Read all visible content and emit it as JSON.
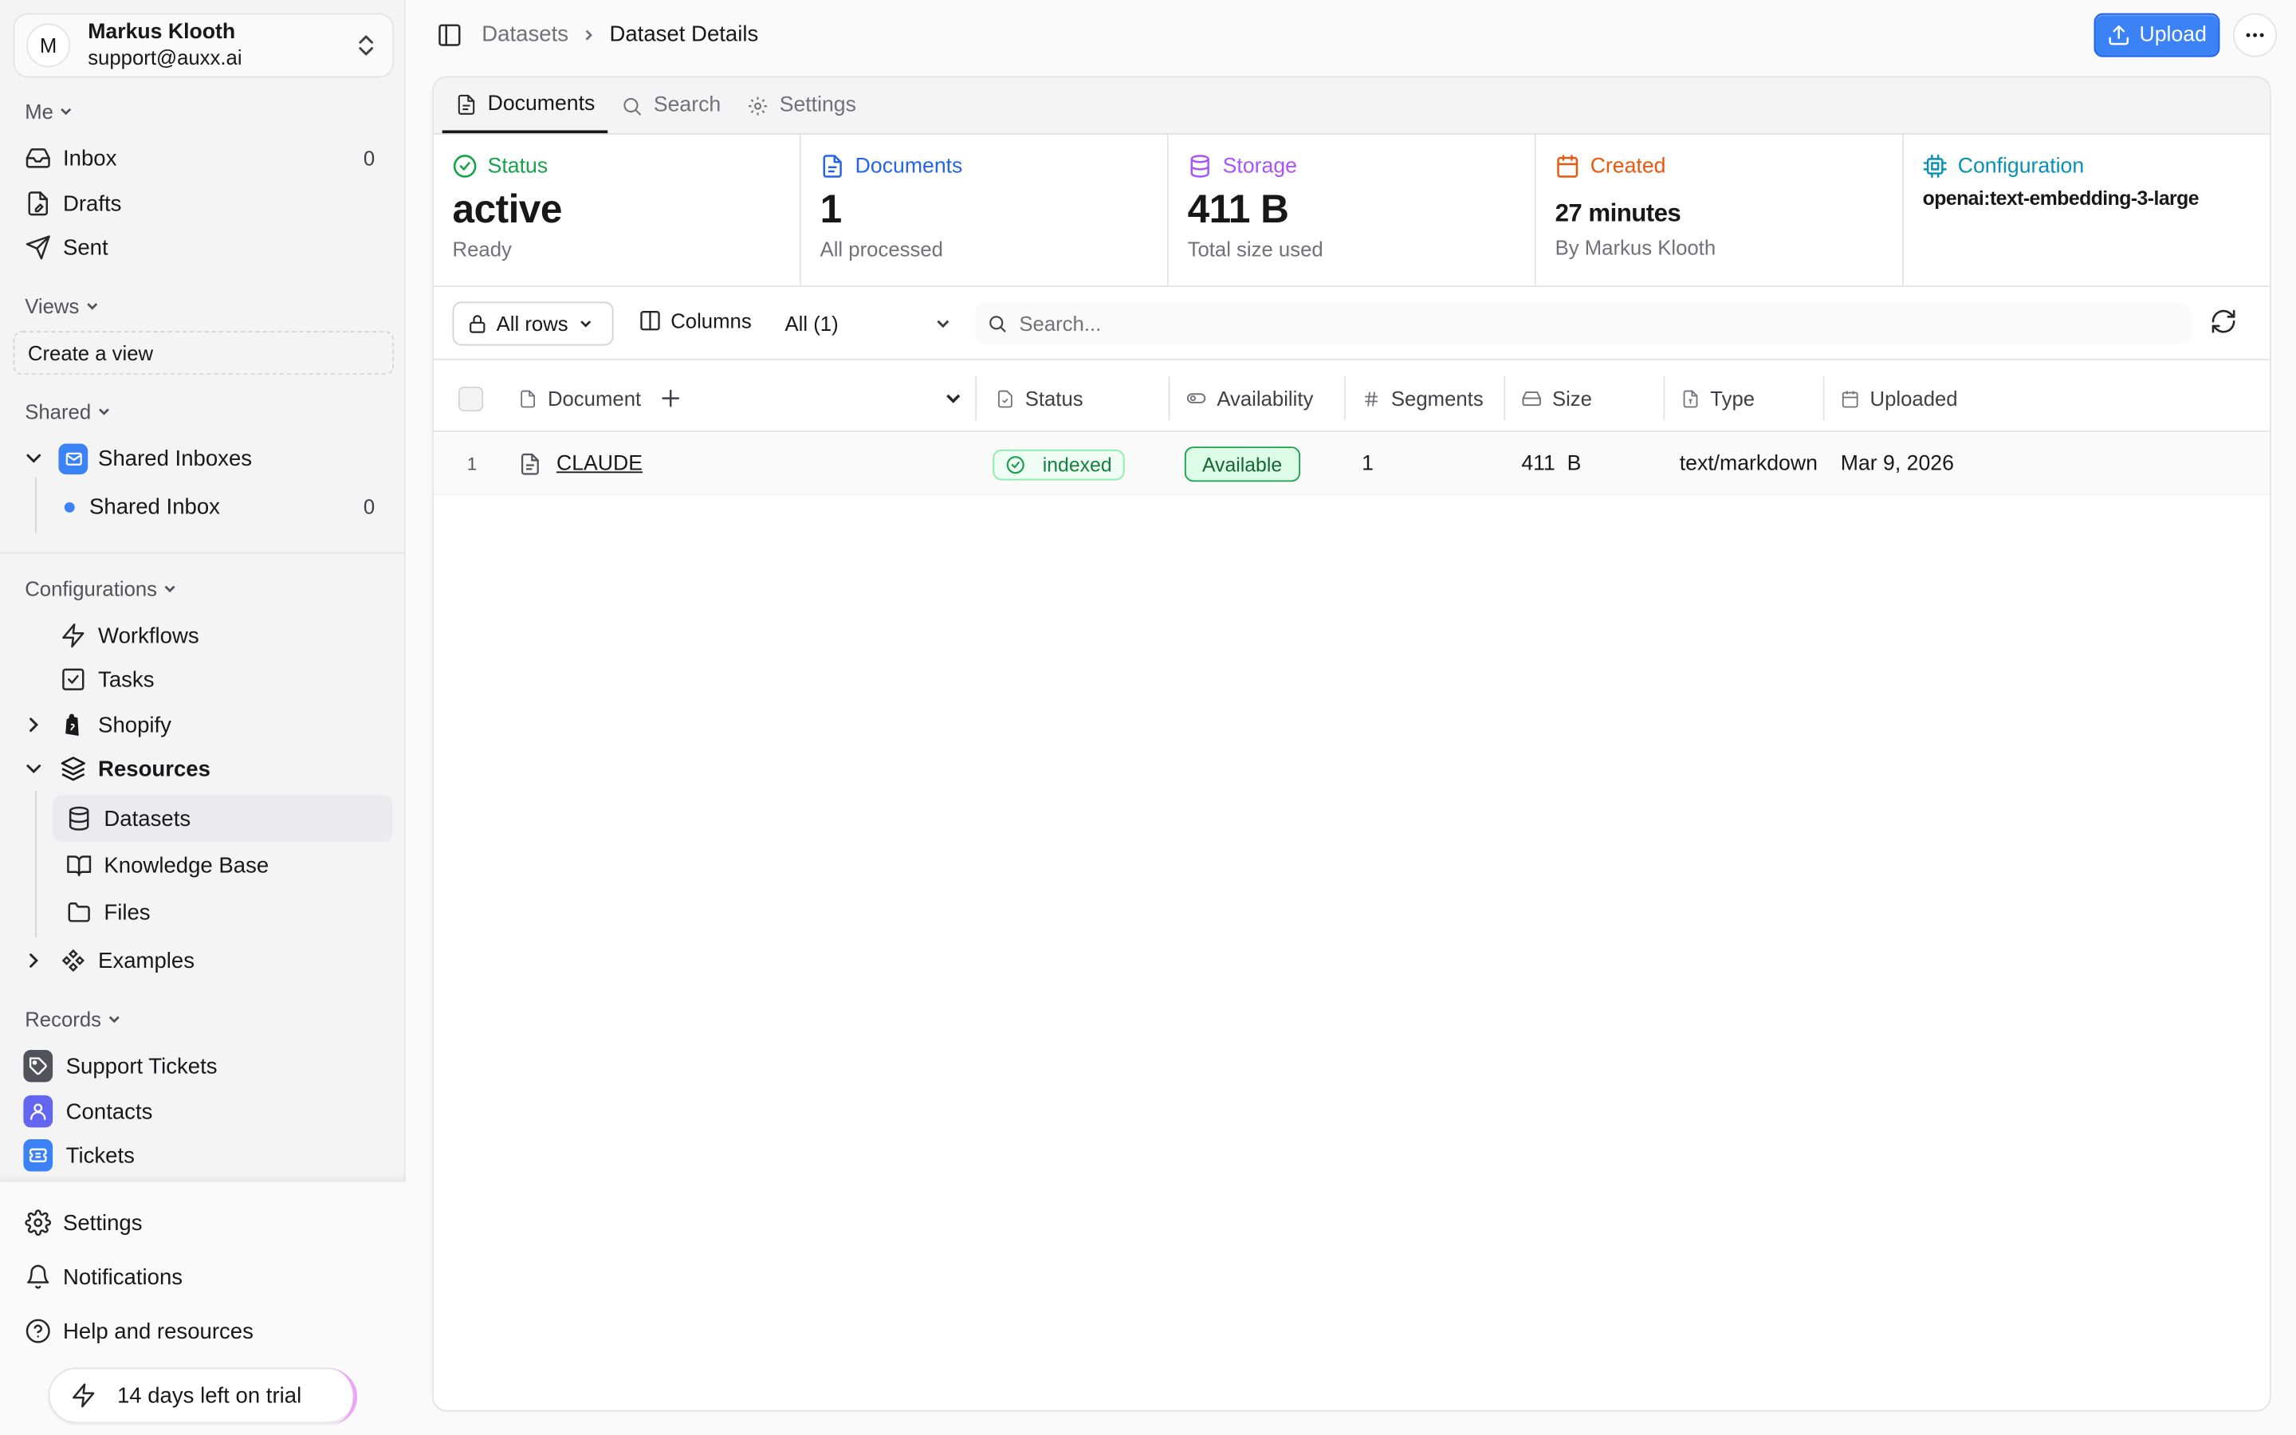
{
  "account": {
    "initial": "M",
    "name": "Markus Klooth",
    "email": "support@auxx.ai"
  },
  "sections": {
    "me": "Me",
    "views": "Views",
    "shared": "Shared",
    "configurations": "Configurations",
    "records": "Records"
  },
  "me_items": [
    {
      "label": "Inbox",
      "count": "0",
      "icon": "inbox-icon"
    },
    {
      "label": "Drafts",
      "icon": "draft-icon"
    },
    {
      "label": "Sent",
      "icon": "send-icon"
    }
  ],
  "views": {
    "create_label": "Create a view"
  },
  "shared": {
    "group_label": "Shared Inboxes",
    "inbox_label": "Shared Inbox",
    "inbox_count": "0"
  },
  "configurations": {
    "workflows": "Workflows",
    "tasks": "Tasks",
    "shopify": "Shopify",
    "resources": "Resources",
    "datasets": "Datasets",
    "knowledge_base": "Knowledge Base",
    "files": "Files",
    "examples": "Examples"
  },
  "records": {
    "support_tickets": "Support Tickets",
    "contacts": "Contacts",
    "tickets": "Tickets"
  },
  "bottom": {
    "settings": "Settings",
    "notifications": "Notifications",
    "help": "Help and resources",
    "trial": "14 days left on trial"
  },
  "breadcrumb": {
    "parent": "Datasets",
    "current": "Dataset Details"
  },
  "actions": {
    "upload": "Upload"
  },
  "tabs": {
    "documents": "Documents",
    "search": "Search",
    "settings": "Settings"
  },
  "stats": {
    "status": {
      "label": "Status",
      "value": "active",
      "sub": "Ready"
    },
    "documents": {
      "label": "Documents",
      "value": "1",
      "sub": "All processed"
    },
    "storage": {
      "label": "Storage",
      "value": "411 B",
      "sub": "Total size used"
    },
    "created": {
      "label": "Created",
      "value": "27 minutes",
      "sub": "By Markus Klooth"
    },
    "configuration": {
      "label": "Configuration",
      "value": "openai:text-embedding-3-large"
    }
  },
  "toolbar": {
    "all_rows": "All rows",
    "columns": "Columns",
    "all_count": "All (1)",
    "search_placeholder": "Search..."
  },
  "table": {
    "headers": {
      "document": "Document",
      "status": "Status",
      "availability": "Availability",
      "segments": "Segments",
      "size": "Size",
      "type": "Type",
      "uploaded": "Uploaded"
    },
    "rows": [
      {
        "index": "1",
        "document": "CLAUDE",
        "status": "indexed",
        "availability": "Available",
        "segments": "1",
        "size": "411  B",
        "type": "text/markdown",
        "uploaded": "Mar 9, 2026"
      }
    ]
  },
  "colors": {
    "accent": "#3b82f6",
    "status": "#16a34a",
    "documents": "#2563eb",
    "storage": "#a855f7",
    "created": "#ea580c",
    "configuration": "#0891b2"
  }
}
